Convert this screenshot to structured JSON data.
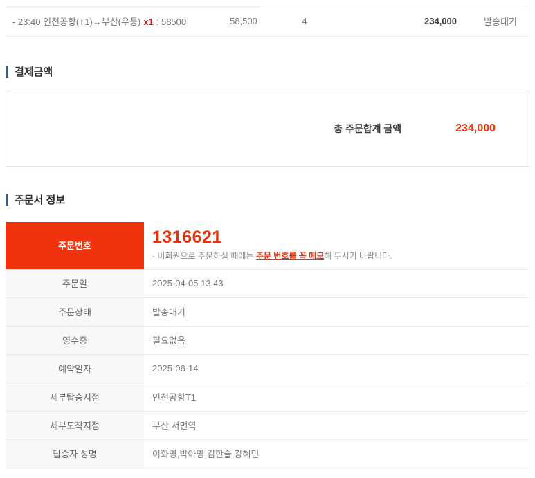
{
  "colors": {
    "accent_orange": "#ee330e",
    "number_red": "#e5310e",
    "amount_red": "#e8320c",
    "status_red": "#e65c38",
    "qty_red": "#d01818",
    "section_bar_navy": "#3e5a75"
  },
  "items_table": {
    "row": {
      "name": "- 23:40 인천공항(T1)→부산(우등)",
      "qty_badge": "x1",
      "price_part": ": 58500",
      "unit_price": "58,500",
      "quantity": "4",
      "total": "234,000",
      "status": "발송대기"
    }
  },
  "payment": {
    "section_title": "결제금액",
    "total_label": "총 주문합계 금액",
    "total_value": "234,000"
  },
  "order_info": {
    "section_title": "주문서 정보",
    "order_number_row": {
      "label": "주문번호",
      "number": "1316621",
      "note_prefix": "- 비회원으로 주문하실 때에는 ",
      "note_em": "주문 번호를 꼭 메모",
      "note_suffix": "해 두시기 바랍니다."
    },
    "rows": [
      {
        "label": "주문일",
        "value": "2025-04-05 13:43"
      },
      {
        "label": "주문상태",
        "value": "발송대기"
      },
      {
        "label": "영수증",
        "value": "필요없음"
      },
      {
        "label": "예약일자",
        "value": "2025-06-14"
      },
      {
        "label": "세부탑승지점",
        "value": "인천공항T1"
      },
      {
        "label": "세부도착지점",
        "value": "부산 서면역"
      },
      {
        "label": "탑승자 성명",
        "value": "이화영,박아영,김한슬,강혜민"
      }
    ]
  }
}
